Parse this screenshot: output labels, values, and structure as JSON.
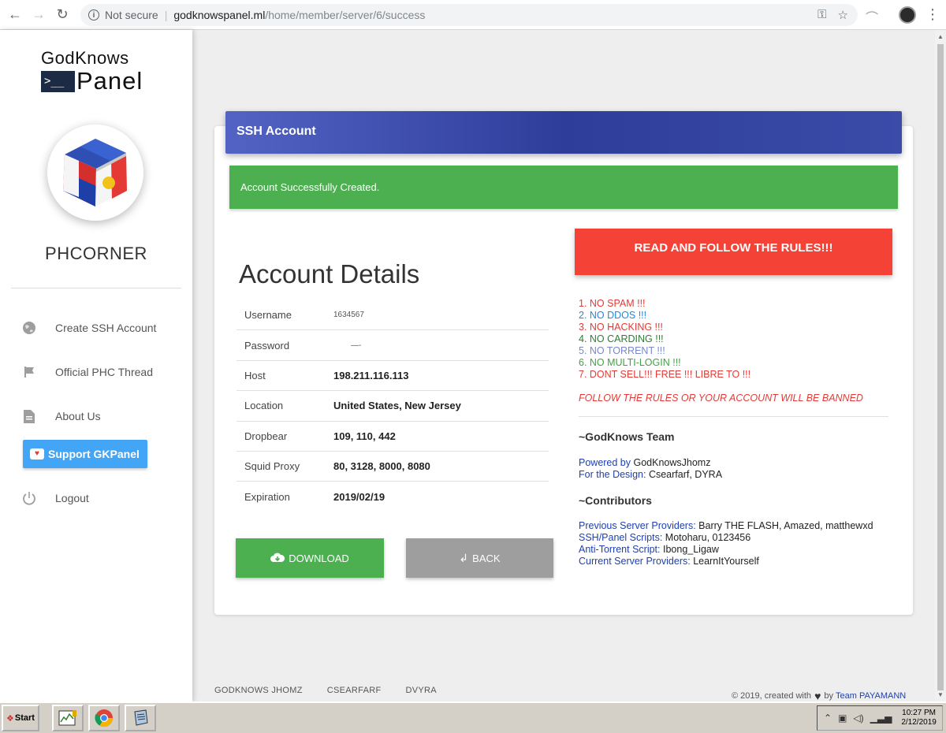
{
  "browser": {
    "security_label": "Not secure",
    "url_host": "godknowspanel.ml",
    "url_path": "/home/member/server/6/success"
  },
  "sidebar": {
    "logo_top": "GodKnows",
    "logo_term": ">__",
    "logo_bottom": "Panel",
    "brand_name": "PHCORNER",
    "menu": {
      "create_ssh": "Create SSH Account",
      "official_thread": "Official PHC Thread",
      "about_us": "About Us",
      "support": "Support GKPanel",
      "logout": "Logout"
    }
  },
  "main": {
    "header_title": "SSH Account",
    "alert_text": "Account Successfully Created.",
    "details_title": "Account Details",
    "details": [
      {
        "label": "Username",
        "value": "1634567"
      },
      {
        "label": "Password",
        "value": "—-"
      },
      {
        "label": "Host",
        "value": "198.211.116.113"
      },
      {
        "label": "Location",
        "value": "United States, New Jersey"
      },
      {
        "label": "Dropbear",
        "value": "109, 110, 442"
      },
      {
        "label": "Squid Proxy",
        "value": "80, 3128, 8000, 8080"
      },
      {
        "label": "Expiration",
        "value": "2019/02/19"
      }
    ],
    "download_label": "DOWNLOAD",
    "back_label": "BACK",
    "rules_banner": "READ AND FOLLOW THE RULES!!!",
    "rules": [
      {
        "text": "1. NO SPAM !!!",
        "color": "#e53935"
      },
      {
        "text": "2. NO DDOS !!!",
        "color": "#1e88e5"
      },
      {
        "text": "3. NO HACKING !!!",
        "color": "#e53935"
      },
      {
        "text": "4. NO CARDING !!!",
        "color": "#2e7d32"
      },
      {
        "text": "5. NO TORRENT !!!",
        "color": "#7986cb"
      },
      {
        "text": "6. NO MULTI-LOGIN !!!",
        "color": "#43a047"
      },
      {
        "text": "7. DONT SELL!!! FREE !!! LIBRE TO !!!",
        "color": "#e53935"
      }
    ],
    "warning": "FOLLOW THE RULES OR YOUR ACCOUNT WILL BE BANNED",
    "team_title": "~GodKnows Team",
    "credits": [
      {
        "label": "Powered by",
        "value": "GodKnowsJhomz"
      },
      {
        "label": "For the Design:",
        "value": "Csearfarf, DYRA"
      }
    ],
    "contributors_title": "~Contributors",
    "contributors": [
      {
        "label": "Previous Server Providers:",
        "value": "Barry THE FLASH, Amazed, matthewxd"
      },
      {
        "label": "SSH/Panel Scripts:",
        "value": "Motoharu, 0123456"
      },
      {
        "label": "Anti-Torrent Script:",
        "value": "Ibong_Ligaw"
      },
      {
        "label": "Current Server Providers:",
        "value": "LearnItYourself"
      }
    ]
  },
  "footer": {
    "links": [
      "GODKNOWS JHOMZ",
      "CSEARFARF",
      "DVYRA"
    ],
    "copyright": "© 2019, created with",
    "by": "by",
    "team": "Team PAYAMANN"
  },
  "taskbar": {
    "start_label": "Start",
    "time": "10:27 PM",
    "date": "2/12/2019"
  }
}
